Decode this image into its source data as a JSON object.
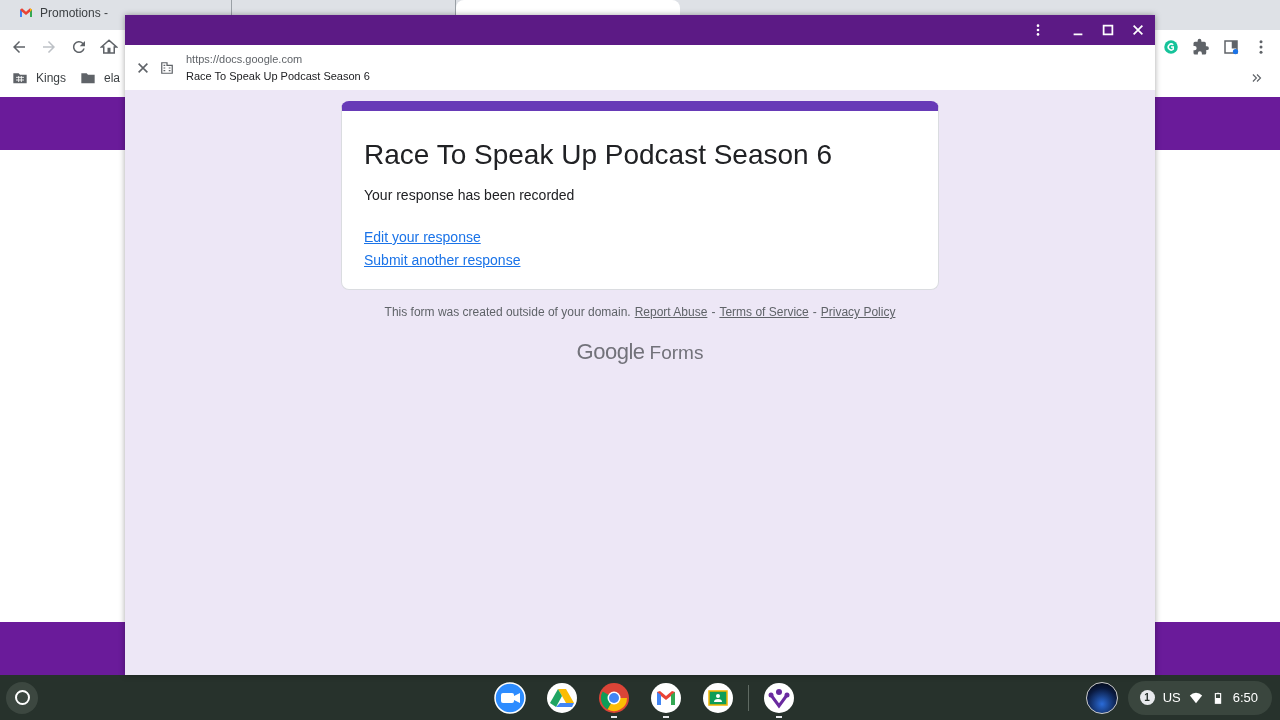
{
  "browser": {
    "tabs": [
      {
        "title": "Promotions -",
        "kind": "gmail",
        "selected": false
      },
      {
        "selected": false
      },
      {
        "selected": true
      }
    ],
    "bookmarks": [
      {
        "label": "Kings",
        "kind": "grid-folder"
      },
      {
        "label": "ela",
        "kind": "folder"
      }
    ]
  },
  "popup": {
    "url": "https://docs.google.com",
    "page_title": "Race To Speak Up Podcast Season 6"
  },
  "form": {
    "title": "Race To Speak Up Podcast Season 6",
    "message": "Your response has been recorded",
    "links": [
      "Edit your response",
      "Submit another response"
    ],
    "footer": [
      {
        "kind": "text",
        "text": "This form was created outside of your domain."
      },
      {
        "kind": "link",
        "text": "Report Abuse"
      },
      {
        "kind": "text",
        "text": "-"
      },
      {
        "kind": "link",
        "text": "Terms of Service"
      },
      {
        "kind": "text",
        "text": "-"
      },
      {
        "kind": "link",
        "text": "Privacy Policy"
      }
    ],
    "brand": {
      "google": "Google",
      "product": "Forms"
    }
  },
  "shelf": {
    "apps": [
      {
        "kind": "zoom",
        "running": false
      },
      {
        "kind": "drive",
        "running": false
      },
      {
        "kind": "chrome",
        "running": true
      },
      {
        "kind": "gmail",
        "running": true
      },
      {
        "kind": "classroom",
        "running": false
      },
      {
        "kind": "innerview",
        "running": true
      }
    ],
    "status": {
      "notifications": "1",
      "keyboard": "US",
      "time": "6:50"
    }
  }
}
